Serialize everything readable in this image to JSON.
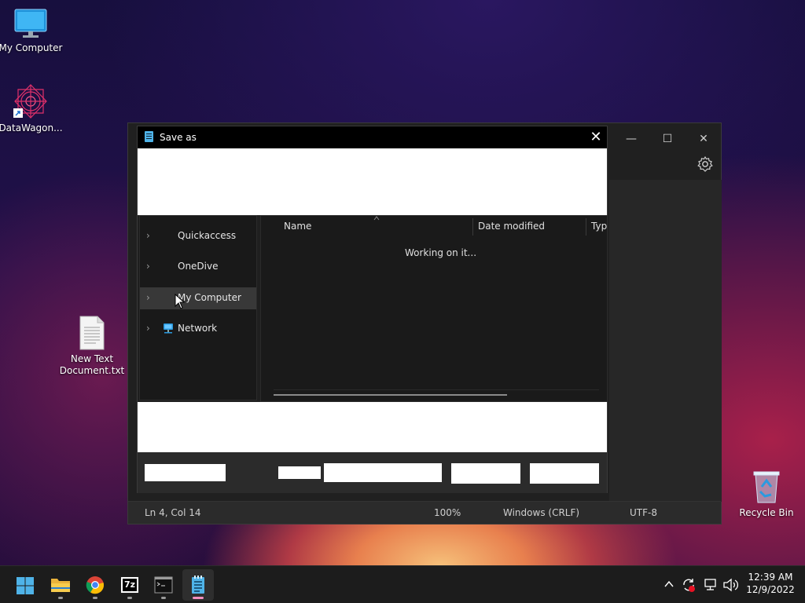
{
  "desktop": {
    "icons": [
      {
        "label": "My Computer",
        "icon": "monitor-icon"
      },
      {
        "label": "DataWagon...",
        "icon": "datawagon-shortcut-icon"
      },
      {
        "label": "New Text Document.txt",
        "icon": "text-file-icon"
      },
      {
        "label": "Recycle Bin",
        "icon": "recycle-bin-icon"
      }
    ]
  },
  "notepad": {
    "controls": {
      "minimize": "—",
      "maximize": "☐",
      "close": "✕"
    },
    "status": {
      "position": "Ln 4, Col 14",
      "zoom": "100%",
      "line_ending": "Windows (CRLF)",
      "encoding": "UTF-8"
    }
  },
  "dialog": {
    "title": "Save as",
    "close": "✕",
    "nav_items": [
      {
        "label": "Quickaccess",
        "icon": "chevron-right-icon"
      },
      {
        "label": "OneDive",
        "icon": "chevron-right-icon"
      },
      {
        "label": "My Computer",
        "icon": "chevron-right-icon",
        "selected": true
      },
      {
        "label": "Network",
        "icon": "network-icon"
      }
    ],
    "columns": [
      "Name",
      "Date modified",
      "Typ"
    ],
    "status_message": "Working on it..."
  },
  "taskbar": {
    "apps": [
      {
        "name": "start",
        "icon": "windows-start-icon"
      },
      {
        "name": "file-explorer",
        "icon": "folder-icon"
      },
      {
        "name": "chrome",
        "icon": "chrome-icon"
      },
      {
        "name": "7zip",
        "icon": "7zip-icon",
        "label": "7z"
      },
      {
        "name": "terminal",
        "icon": "terminal-icon"
      },
      {
        "name": "notepad",
        "icon": "notepad-icon",
        "active": true
      }
    ],
    "clock": {
      "time": "12:39 AM",
      "date": "12/9/2022"
    }
  },
  "colors": {
    "accent": "#4fb3e8",
    "active_indicator": "#f48fbf",
    "dialog_bg": "#1f1f1f",
    "taskbar_bg": "#1c1c1c"
  }
}
